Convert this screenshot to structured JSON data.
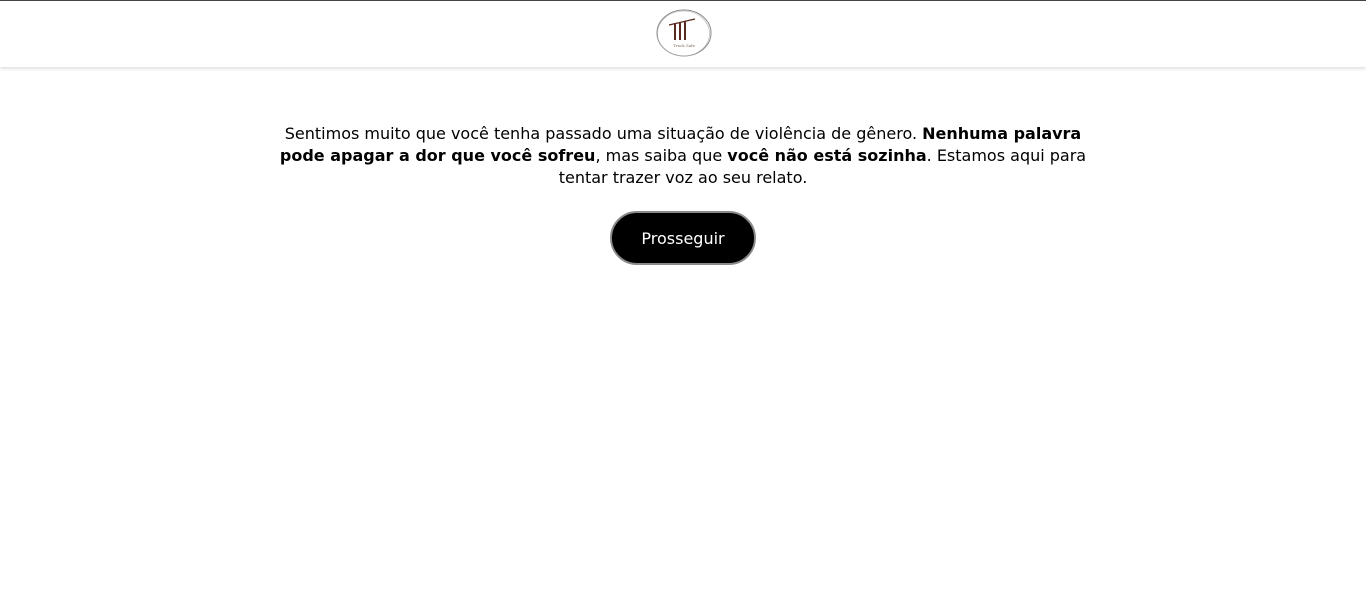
{
  "header": {
    "logo_icon": "track-safe-logo-icon",
    "logo_text": "Track Safe"
  },
  "message": {
    "part1": "Sentimos muito que você tenha passado uma situação de violência de gênero. ",
    "bold1": "Nenhuma palavra pode apagar a dor que você sofreu",
    "part2": ", mas saiba que ",
    "bold2": "você não está sozinha",
    "part3": ". Estamos aqui para tentar trazer voz ao seu relato."
  },
  "actions": {
    "proceed_label": "Prosseguir"
  },
  "colors": {
    "background": "#ffffff",
    "button": "#000000",
    "button_text": "#ffffff",
    "logo_accent": "#5a2a1e"
  }
}
